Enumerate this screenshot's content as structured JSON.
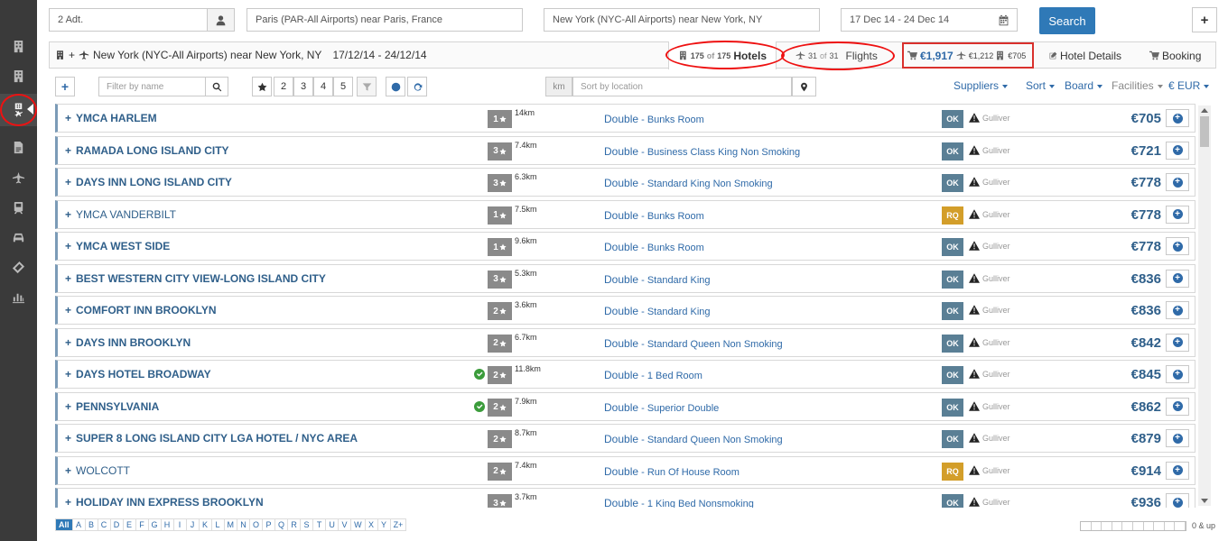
{
  "search": {
    "passengers": "2 Adt.",
    "origin": "Paris (PAR-All Airports) near Paris, France",
    "destination": "New York (NYC-All Airports) near New York, NY",
    "dates": "17 Dec 14 - 24 Dec 14",
    "search_label": "Search",
    "add_label": "+"
  },
  "trip": {
    "plus": "+",
    "title": "New York (NYC-All Airports) near New York, NY",
    "dates": "17/12/14 - 24/12/14"
  },
  "tabs": {
    "hotels": {
      "count": "175",
      "of": "of",
      "total": "175",
      "label": "Hotels"
    },
    "flights": {
      "count": "31",
      "of": "of",
      "total": "31",
      "label": "Flights"
    },
    "price": {
      "total": "€1,917",
      "flight": "€1,212",
      "hotel": "€705"
    },
    "hotel_details": "Hotel Details",
    "booking": "Booking"
  },
  "filters": {
    "add": "+",
    "name_placeholder": "Filter by name",
    "star_buttons": [
      "2",
      "3",
      "4",
      "5"
    ],
    "km": "km",
    "location_placeholder": "Sort by location",
    "suppliers": "Suppliers",
    "sort": "Sort",
    "board": "Board",
    "facilities": "Facilities",
    "currency": "€ EUR"
  },
  "hotels": [
    {
      "name": "YMCA HARLEM",
      "bold": true,
      "checked": false,
      "stars": "1",
      "dist": "14km",
      "room_type": "Double",
      "room": "Bunks Room",
      "status": "OK",
      "supplier": "Gulliver",
      "price": "€705"
    },
    {
      "name": "RAMADA LONG ISLAND CITY",
      "bold": true,
      "checked": false,
      "stars": "3",
      "dist": "7.4km",
      "room_type": "Double",
      "room": "Business Class King Non Smoking",
      "status": "OK",
      "supplier": "Gulliver",
      "price": "€721"
    },
    {
      "name": "DAYS INN LONG ISLAND CITY",
      "bold": true,
      "checked": false,
      "stars": "3",
      "dist": "6.3km",
      "room_type": "Double",
      "room": "Standard King Non Smoking",
      "status": "OK",
      "supplier": "Gulliver",
      "price": "€778"
    },
    {
      "name": "YMCA VANDERBILT",
      "bold": false,
      "checked": false,
      "stars": "1",
      "dist": "7.5km",
      "room_type": "Double",
      "room": "Bunks Room",
      "status": "RQ",
      "supplier": "Gulliver",
      "price": "€778"
    },
    {
      "name": "YMCA WEST SIDE",
      "bold": true,
      "checked": false,
      "stars": "1",
      "dist": "9.6km",
      "room_type": "Double",
      "room": "Bunks Room",
      "status": "OK",
      "supplier": "Gulliver",
      "price": "€778"
    },
    {
      "name": "BEST WESTERN CITY VIEW-LONG ISLAND CITY",
      "bold": true,
      "checked": false,
      "stars": "3",
      "dist": "5.3km",
      "room_type": "Double",
      "room": "Standard King",
      "status": "OK",
      "supplier": "Gulliver",
      "price": "€836"
    },
    {
      "name": "COMFORT INN BROOKLYN",
      "bold": true,
      "checked": false,
      "stars": "2",
      "dist": "3.6km",
      "room_type": "Double",
      "room": "Standard King",
      "status": "OK",
      "supplier": "Gulliver",
      "price": "€836"
    },
    {
      "name": "DAYS INN BROOKLYN",
      "bold": true,
      "checked": false,
      "stars": "2",
      "dist": "6.7km",
      "room_type": "Double",
      "room": "Standard Queen Non Smoking",
      "status": "OK",
      "supplier": "Gulliver",
      "price": "€842"
    },
    {
      "name": "DAYS HOTEL BROADWAY",
      "bold": true,
      "checked": true,
      "stars": "2",
      "dist": "11.8km",
      "room_type": "Double",
      "room": "1 Bed Room",
      "status": "OK",
      "supplier": "Gulliver",
      "price": "€845"
    },
    {
      "name": "PENNSYLVANIA",
      "bold": true,
      "checked": true,
      "stars": "2",
      "dist": "7.9km",
      "room_type": "Double",
      "room": "Superior Double",
      "status": "OK",
      "supplier": "Gulliver",
      "price": "€862"
    },
    {
      "name": "SUPER 8 LONG ISLAND CITY LGA HOTEL / NYC AREA",
      "bold": true,
      "checked": false,
      "stars": "2",
      "dist": "8.7km",
      "room_type": "Double",
      "room": "Standard Queen Non Smoking",
      "status": "OK",
      "supplier": "Gulliver",
      "price": "€879"
    },
    {
      "name": "WOLCOTT",
      "bold": false,
      "checked": false,
      "stars": "2",
      "dist": "7.4km",
      "room_type": "Double",
      "room": "Run Of House Room",
      "status": "RQ",
      "supplier": "Gulliver",
      "price": "€914"
    },
    {
      "name": "HOLIDAY INN EXPRESS BROOKLYN",
      "bold": true,
      "checked": false,
      "stars": "3",
      "dist": "3.7km",
      "room_type": "Double",
      "room": "1 King Bed Nonsmoking",
      "status": "OK",
      "supplier": "Gulliver",
      "price": "€936"
    }
  ],
  "alphabet": [
    "All",
    "A",
    "B",
    "C",
    "D",
    "E",
    "F",
    "G",
    "H",
    "I",
    "J",
    "K",
    "L",
    "M",
    "N",
    "O",
    "P",
    "Q",
    "R",
    "S",
    "T",
    "U",
    "V",
    "W",
    "X",
    "Y",
    "Z+"
  ],
  "price_filter_label": "0 & up",
  "colors": {
    "accent": "#2f79b7",
    "link": "#2f6aa8",
    "ok": "#5a7f95",
    "rq": "#d39e2a",
    "annotation": "#e11111",
    "sidebar": "#3a3a3a"
  },
  "sidebar_icons": [
    "hotel-icon",
    "hotel-icon",
    "hotel-flight-icon",
    "pdf-icon",
    "plane-icon",
    "train-icon",
    "car-icon",
    "ticket-icon",
    "chart-icon"
  ]
}
